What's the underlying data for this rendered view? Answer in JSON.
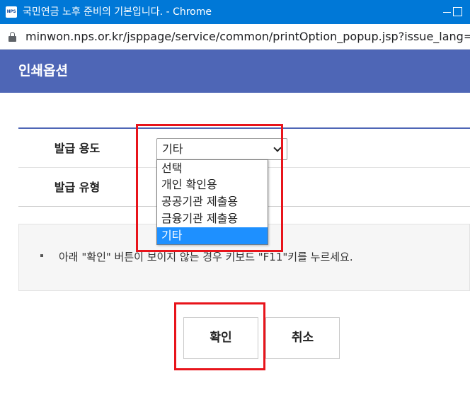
{
  "window": {
    "favicon_label": "NPS",
    "title": "국민연금 노후 준비의 기본입니다. - Chrome"
  },
  "address_bar": {
    "url": "minwon.nps.or.kr/jsppage/service/common/printOption_popup.jsp?issue_lang="
  },
  "header": {
    "title": "인쇄옵션"
  },
  "form": {
    "issue_purpose": {
      "label": "발급 용도",
      "selected": "기타",
      "options": [
        "선택",
        "개인 확인용",
        "공공기관 제출용",
        "금융기관 제출용",
        "기타"
      ]
    },
    "issue_type": {
      "label": "발급 유형"
    }
  },
  "notice": {
    "text": "아래 \"확인\" 버튼이 보이지 않는 경우 키보드 \"F11\"키를 누르세요."
  },
  "buttons": {
    "confirm": "확인",
    "cancel": "취소"
  },
  "colors": {
    "titlebar": "#0078d7",
    "header": "#4e66b6",
    "selected_option": "#1e90ff",
    "highlight": "#e8141b"
  }
}
